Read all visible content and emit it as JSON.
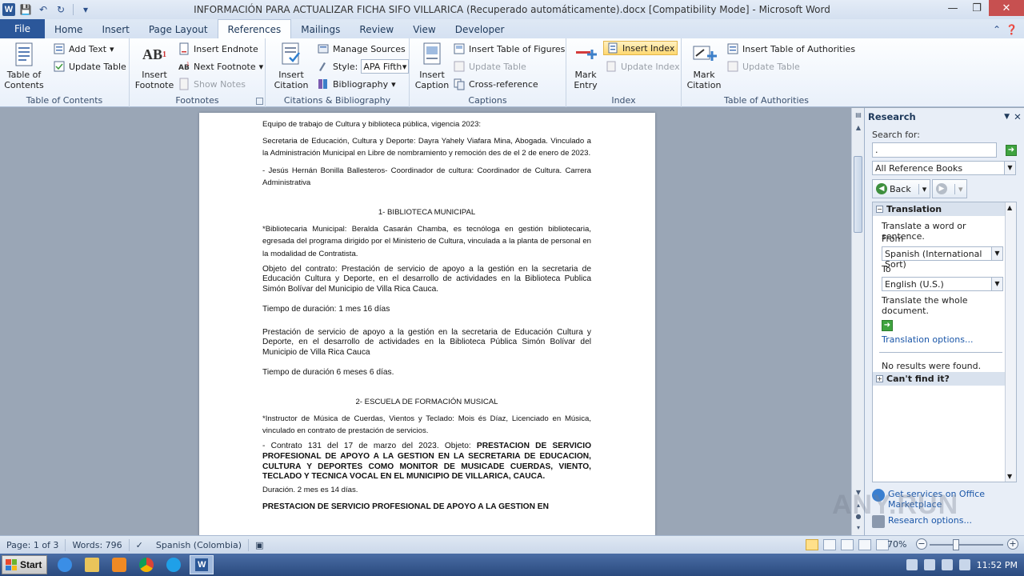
{
  "window": {
    "title": "INFORMACIÓN PARA ACTUALIZAR FICHA SIFO VILLARICA (Recuperado automáticamente).docx [Compatibility Mode]  -  Microsoft Word",
    "app_letter": "W"
  },
  "tabs": [
    "File",
    "Home",
    "Insert",
    "Page Layout",
    "References",
    "Mailings",
    "Review",
    "View",
    "Developer"
  ],
  "active_tab": "References",
  "ribbon": {
    "toc": {
      "table_of_contents": "Table of Contents",
      "add_text": "Add Text",
      "update_table": "Update Table",
      "label": "Table of Contents"
    },
    "footnotes": {
      "insert_footnote": "Insert Footnote",
      "insert_endnote": "Insert Endnote",
      "next_footnote": "Next Footnote",
      "show_notes": "Show Notes",
      "label": "Footnotes",
      "icon_text": "AB"
    },
    "citations": {
      "insert_citation": "Insert Citation",
      "manage_sources": "Manage Sources",
      "style_label": "Style:",
      "style_value": "APA Fifth",
      "bibliography": "Bibliography",
      "label": "Citations & Bibliography"
    },
    "captions": {
      "insert_caption": "Insert Caption",
      "insert_tof": "Insert Table of Figures",
      "update_table": "Update Table",
      "cross_reference": "Cross-reference",
      "label": "Captions"
    },
    "index": {
      "mark_entry": "Mark Entry",
      "insert_index": "Insert Index",
      "update_index": "Update Index",
      "label": "Index"
    },
    "toa": {
      "mark_citation": "Mark Citation",
      "insert_toa": "Insert Table of Authorities",
      "update_table": "Update Table",
      "label": "Table of Authorities"
    }
  },
  "document": {
    "p1": "Equipo de trabajo de Cultura y biblioteca pública, vigencia 2023:",
    "p2": "Secretaria de Educación, Cultura y Deporte: Dayra Yahely Viafara Mina, Abogada. Vinculado a la Administración Municipal en Libre de nombramiento y remoción des de el 2 de enero de 2023.",
    "p3": "- Jesús Hernán Bonilla Ballesteros- Coordinador de cultura: Coordinador de Cultura. Carrera Administrativa",
    "h1": "1- BIBLIOTECA MUNICIPAL",
    "p4": "*Bibliotecaria Municipal: Beralda Casarán Chamba, es tecnóloga en gestión bibliotecaria, egresada del programa dirigido por el Ministerio de Cultura, vinculada a la planta de personal en la modalidad de Contratista.",
    "p5": "Objeto del contrato: Prestación de servicio de apoyo a la gestión en la secretaria de Educación Cultura y Deporte, en el desarrollo de actividades en la Biblioteca Publica Simón Bolívar del Municipio de Villa Rica Cauca.",
    "p6": "Tiempo de duración:  1 mes 16 días",
    "p7": "Prestación de servicio de apoyo a la gestión en la secretaria de Educación Cultura y Deporte, en el desarrollo de actividades en la Biblioteca Pública Simón Bolívar del Municipio de Villa Rica Cauca",
    "p8": "Tiempo de duración 6 meses 6 días.",
    "h2": "2- ESCUELA DE FORMACIÓN MUSICAL",
    "p9": "*Instructor de Música de Cuerdas, Vientos y Teclado: Mois és Díaz, Licenciado en Música, vinculado en contrato de prestación de servicios.",
    "p10_normal": "- Contrato 131 del 17 de marzo del 2023. Objeto: ",
    "p10_bold": "PRESTACION DE SERVICIO PROFESIONAL DE APOYO A LA GESTION EN LA SECRETARIA DE EDUCACION, CULTURA Y DEPORTES COMO MONITOR DE MUSICADE CUERDAS, VIENTO, TECLADO Y TECNICA VOCAL EN EL MUNICIPIO DE VILLARICA, CAUCA.",
    "p11": "Duración. 2 mes es 14 días.",
    "p12": "PRESTACION DE SERVICIO PROFESIONAL DE APOYO A LA GESTION EN"
  },
  "research": {
    "title": "Research",
    "search_for": "Search for:",
    "search_value": ".",
    "source": "All Reference Books",
    "back": "Back",
    "translation": "Translation",
    "translate_hint": "Translate a word or sentence.",
    "from": "From",
    "from_value": "Spanish (International Sort)",
    "to": "To",
    "to_value": "English (U.S.)",
    "translate_doc": "Translate the whole document.",
    "translation_options": "Translation options...",
    "no_results": "No results were found.",
    "cant_find": "Can't find it?",
    "get_services": "Get services on Office Marketplace",
    "research_options": "Research options..."
  },
  "status": {
    "page": "Page: 1 of 3",
    "words": "Words: 796",
    "language": "Spanish (Colombia)",
    "zoom": "70%"
  },
  "taskbar": {
    "start": "Start",
    "time": "11:52 PM"
  },
  "watermark": "ANY.RUN"
}
